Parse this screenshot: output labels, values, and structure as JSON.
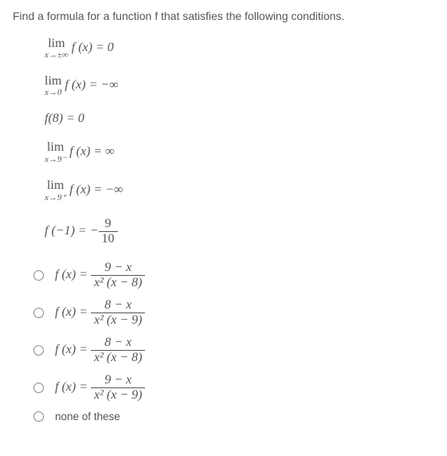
{
  "question": "Find a formula for a function f that satisfies the following conditions.",
  "conditions": {
    "c1_lim": "lim",
    "c1_under": "x→±∞",
    "c1_body": "f (x) = 0",
    "c2_lim": "lim",
    "c2_under": "x→0",
    "c2_body": "f (x) = −∞",
    "c3": "f(8) = 0",
    "c4_lim": "lim",
    "c4_under": "x→9⁻",
    "c4_body": "f (x) = ∞",
    "c5_lim": "lim",
    "c5_under": "x→9⁺",
    "c5_body": "f (x) = −∞",
    "c6_left": "f (−1) = −",
    "c6_num": "9",
    "c6_den": "10"
  },
  "options": {
    "o1_left": "f (x) = ",
    "o1_num": "9 − x",
    "o1_den": "x² (x − 8)",
    "o2_left": "f (x) = ",
    "o2_num": "8 − x",
    "o2_den": "x² (x − 9)",
    "o3_left": "f (x) = ",
    "o3_num": "8 − x",
    "o3_den": "x² (x − 8)",
    "o4_left": "f (x) = ",
    "o4_num": "9 − x",
    "o4_den": "x² (x − 9)",
    "o5": "none of these"
  }
}
